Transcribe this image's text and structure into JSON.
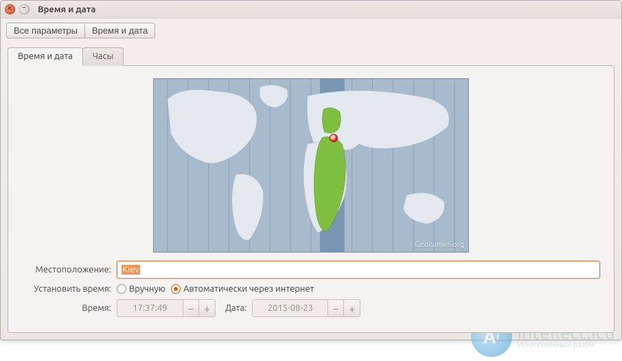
{
  "window": {
    "title": "Время и дата"
  },
  "breadcrumb": {
    "all_settings": "Все параметры",
    "current": "Время и дата"
  },
  "tabs": {
    "time_and_date": "Время и дата",
    "clocks": "Часы"
  },
  "map": {
    "attribution": "Geonames.org"
  },
  "form": {
    "location_label": "Местоположение:",
    "location_value": "Kiev",
    "set_time_label": "Установить время:",
    "radio_manual": "Вручную",
    "radio_auto": "Автоматически через интернет",
    "selected_mode": "auto",
    "time_label": "Время:",
    "time_value": "17:37:49",
    "date_label": "Дата:",
    "date_value": "2015-08-23"
  },
  "watermark": {
    "logo_main": "A",
    "logo_sub": "i",
    "title": "intellect.icu",
    "subtitle": "Искусственный разум"
  }
}
